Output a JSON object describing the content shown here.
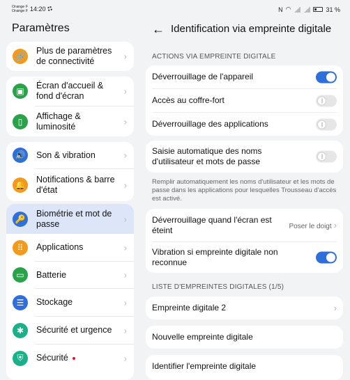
{
  "status": {
    "carrier1": "Orange F",
    "carrier2": "Orange F",
    "time": "14:20",
    "battery": "31 %"
  },
  "left": {
    "title": "Paramètres",
    "items": [
      {
        "label": "Plus de paramètres de connectivité",
        "icon": "link-icon",
        "color": "#f39a1c"
      },
      {
        "label": "Écran d'accueil & fond d'écran",
        "icon": "wallpaper-icon",
        "color": "#2aa24a"
      },
      {
        "label": "Affichage & luminosité",
        "icon": "display-icon",
        "color": "#2aa24a"
      },
      {
        "label": "Son & vibration",
        "icon": "speaker-icon",
        "color": "#2e6fdb"
      },
      {
        "label": "Notifications & barre d'état",
        "icon": "bell-icon",
        "color": "#f39a1c"
      },
      {
        "label": "Biométrie et mot de passe",
        "icon": "key-icon",
        "color": "#2e6fdb"
      },
      {
        "label": "Applications",
        "icon": "apps-icon",
        "color": "#f39a1c"
      },
      {
        "label": "Batterie",
        "icon": "battery-icon",
        "color": "#2aa24a"
      },
      {
        "label": "Stockage",
        "icon": "storage-icon",
        "color": "#2e6fdb"
      },
      {
        "label": "Sécurité et urgence",
        "icon": "asterisk-icon",
        "color": "#1cb08a"
      },
      {
        "label": "Sécurité",
        "icon": "shield-icon",
        "color": "#1cb08a"
      }
    ]
  },
  "right": {
    "title": "Identification via empreinte digitale",
    "section1": "ACTIONS VIA EMPREINTE DIGITALE",
    "rows": {
      "unlock": "Déverrouillage de l'appareil",
      "vault": "Accès au coffre-fort",
      "apps": "Déverrouillage des applications",
      "autofill": "Saisie automatique des noms d'utilisateur et mots de passe",
      "autofill_note": "Remplir automatiquement les noms d'utilisateur et les mots de passe dans les applications pour lesquelles Trousseau d'accès est activé.",
      "screen_off": "Déverrouillage quand l'écran est éteint",
      "screen_off_value": "Poser le doigt",
      "vibration": "Vibration si empreinte digitale non reconnue"
    },
    "toggles": {
      "unlock": true,
      "vault": false,
      "apps": false,
      "autofill": false,
      "vibration": true
    },
    "section2": "LISTE D'EMPREINTES DIGITALES (1/5)",
    "fingerprint": "Empreinte digitale 2",
    "new_fp": "Nouvelle empreinte digitale",
    "identify_fp": "Identifier l'empreinte digitale"
  }
}
